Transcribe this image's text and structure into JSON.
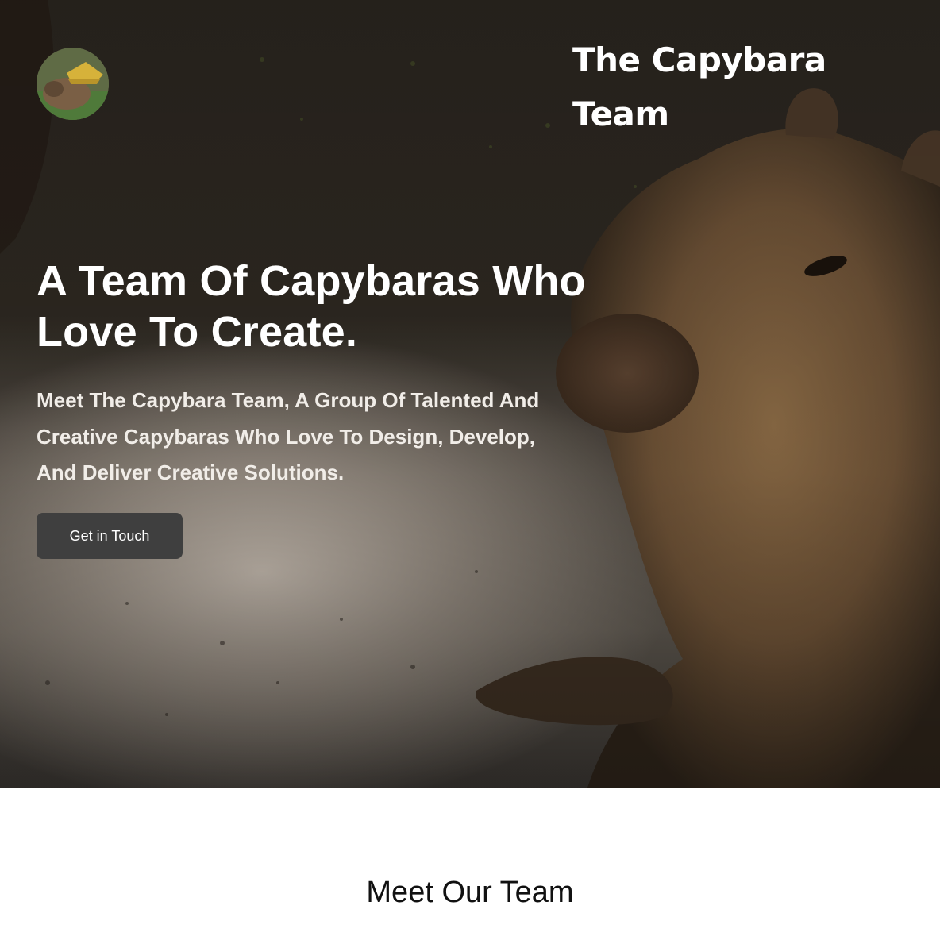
{
  "header": {
    "logo_icon": "capybara-avatar-logo",
    "brand_name": "The Capybara Team"
  },
  "hero": {
    "headline": "A Team Of Capybaras Who Love To Create.",
    "subtext": "Meet The Capybara Team, A Group Of Talented And Creative Capybaras Who Love To Design, Develop, And Deliver Creative Solutions.",
    "cta_label": "Get in Touch",
    "background_image": "capybara-photo"
  },
  "team_section": {
    "title": "Meet Our Team"
  },
  "colors": {
    "cta_background": "#3f3f3f",
    "text_light": "#ffffff",
    "text_dark": "#111111"
  }
}
